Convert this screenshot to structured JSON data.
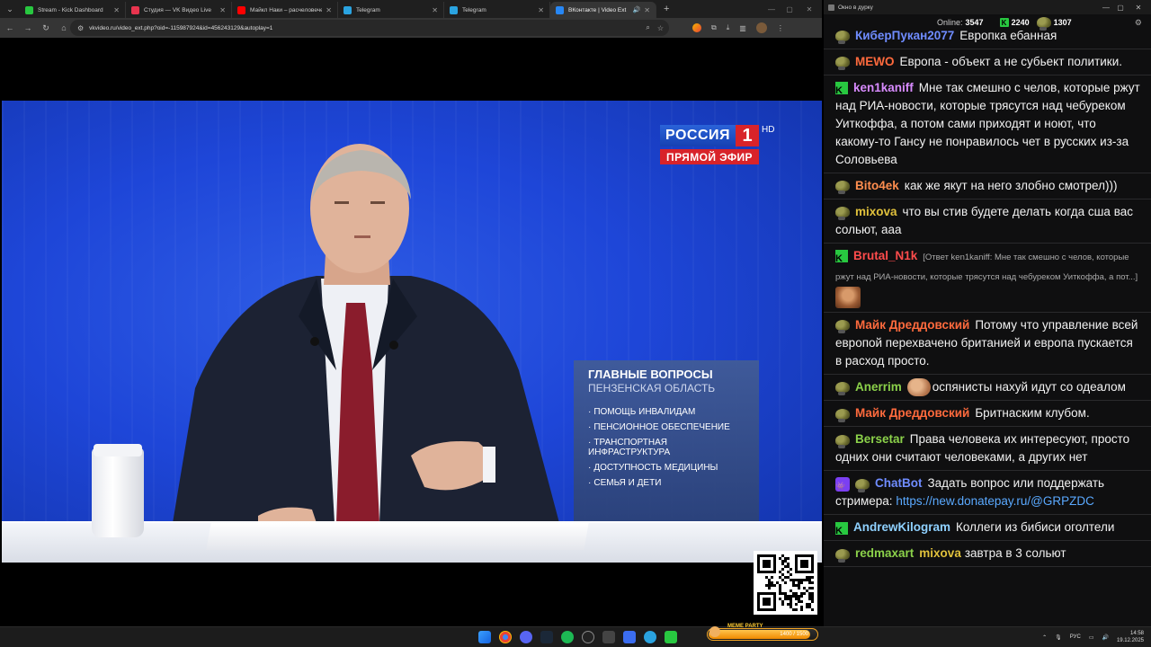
{
  "browser": {
    "tabs": [
      {
        "title": "Stream - Kick Dashboard",
        "favicon": "kick-icon",
        "color": "#28c840",
        "active": false
      },
      {
        "title": "Студия — VK Видео Live",
        "favicon": "vk-video-icon",
        "color": "#e8344e",
        "active": false
      },
      {
        "title": "Майкл Наки – расчеловечен...",
        "favicon": "youtube-icon",
        "color": "#ff0000",
        "active": false
      },
      {
        "title": "Telegram",
        "favicon": "telegram-icon",
        "color": "#2aa3e0",
        "active": false
      },
      {
        "title": "Telegram",
        "favicon": "telegram-icon",
        "color": "#2aa3e0",
        "active": false
      },
      {
        "title": "ВКонтакте | Video Ext",
        "favicon": "vk-icon",
        "color": "#2787f5",
        "active": true
      }
    ],
    "url": "vkvideo.ru/video_ext.php?oid=-115987924&id=456243129&autoplay=1"
  },
  "video": {
    "channel_name": "РОССИЯ",
    "channel_number": "1",
    "hd_label": "HD",
    "live_label": "ПРЯМОЙ ЭФИР",
    "panel_title": "ГЛАВНЫЕ ВОПРОСЫ",
    "panel_subtitle": "ПЕНЗЕНСКАЯ ОБЛАСТЬ",
    "topics": [
      "ПОМОЩЬ ИНВАЛИДАМ",
      "ПЕНСИОННОЕ ОБЕСПЕЧЕНИЕ",
      "ТРАНСПОРТНАЯ ИНФРАСТРУКТУРА",
      "ДОСТУПНОСТЬ МЕДИЦИНЫ",
      "СЕМЬЯ И ДЕТИ"
    ]
  },
  "chat": {
    "window_title": "Окно в дурку",
    "online_label": "Online:",
    "online_count": "3547",
    "kick_count": "2240",
    "other_count": "1307",
    "messages": [
      {
        "badge": "frog",
        "user": "КиберПукан2077",
        "color": "#6f8cff",
        "text": "Европка ебанная"
      },
      {
        "badge": "frog",
        "user": "MEWO",
        "color": "#ff6a3d",
        "text": "Европа - объект а не субьект политики."
      },
      {
        "badge": "kick",
        "user": "ken1kaniff",
        "color": "#d88bff",
        "text": "Мне так смешно с челов, которые ржут над РИА-новости, которые трясутся над чебуреком Уиткоффа, а потом сами приходят и ноют, что какому-то Гансу не понравилось чет в русских из-за Соловьева"
      },
      {
        "badge": "frog",
        "user": "Bito4ek",
        "color": "#ff8e4f",
        "text": "как же якут на него злобно смотрел)))"
      },
      {
        "badge": "frog",
        "user": "mixova",
        "color": "#e0c13c",
        "text": "что вы стив будете делать когда сша вас сольют, ааа"
      },
      {
        "badge": "kick",
        "user": "Brutal_N1k",
        "color": "#ff4c4c",
        "reply": "[Ответ ken1kaniff: Мне так смешно с челов, которые ржут над РИА-новости, которые трясутся над чебуреком Уиткоффа, а пот...]",
        "text": ""
      },
      {
        "badge": "frog",
        "user": "Майк Дреддовский",
        "color": "#ff6a3d",
        "text": "Потому что управление всей европой перехвачено британией и европа пускается в расход просто."
      },
      {
        "badge": "frog",
        "user": "Anerrim",
        "color": "#8bd14a",
        "text": "оспянисты нахуй идут со одеалом"
      },
      {
        "badge": "frog",
        "user": "Майк Дреддовский",
        "color": "#ff6a3d",
        "text": "Бритнаским клубом."
      },
      {
        "badge": "frog",
        "user": "Bersetar",
        "color": "#8bd14a",
        "text": "Права человека их интересуют, просто одних они считают человеками, а других нет"
      },
      {
        "badge": "bot",
        "user": "ChatBot",
        "color": "#6f8cff",
        "text": "Задать вопрос или поддержать стримера:",
        "link": "https://new.donatepay.ru/@GRPZDC"
      },
      {
        "badge": "kick",
        "user": "AndrewKilogram",
        "color": "#8fd1ff",
        "text": "Коллеги из бибиси оголтели"
      },
      {
        "badge": "frog",
        "user": "redmaxart",
        "color": "#8bd14a",
        "mention": "mixova",
        "mention_color": "#e0c13c",
        "text": "завтра в 3 сольют"
      }
    ]
  },
  "taskbar": {
    "meme_label": "MEME PARTY",
    "meme_value": "1400 / 1500",
    "meme_progress": 0.93,
    "language": "РУС",
    "time": "14:58",
    "date": "19.12.2025"
  }
}
